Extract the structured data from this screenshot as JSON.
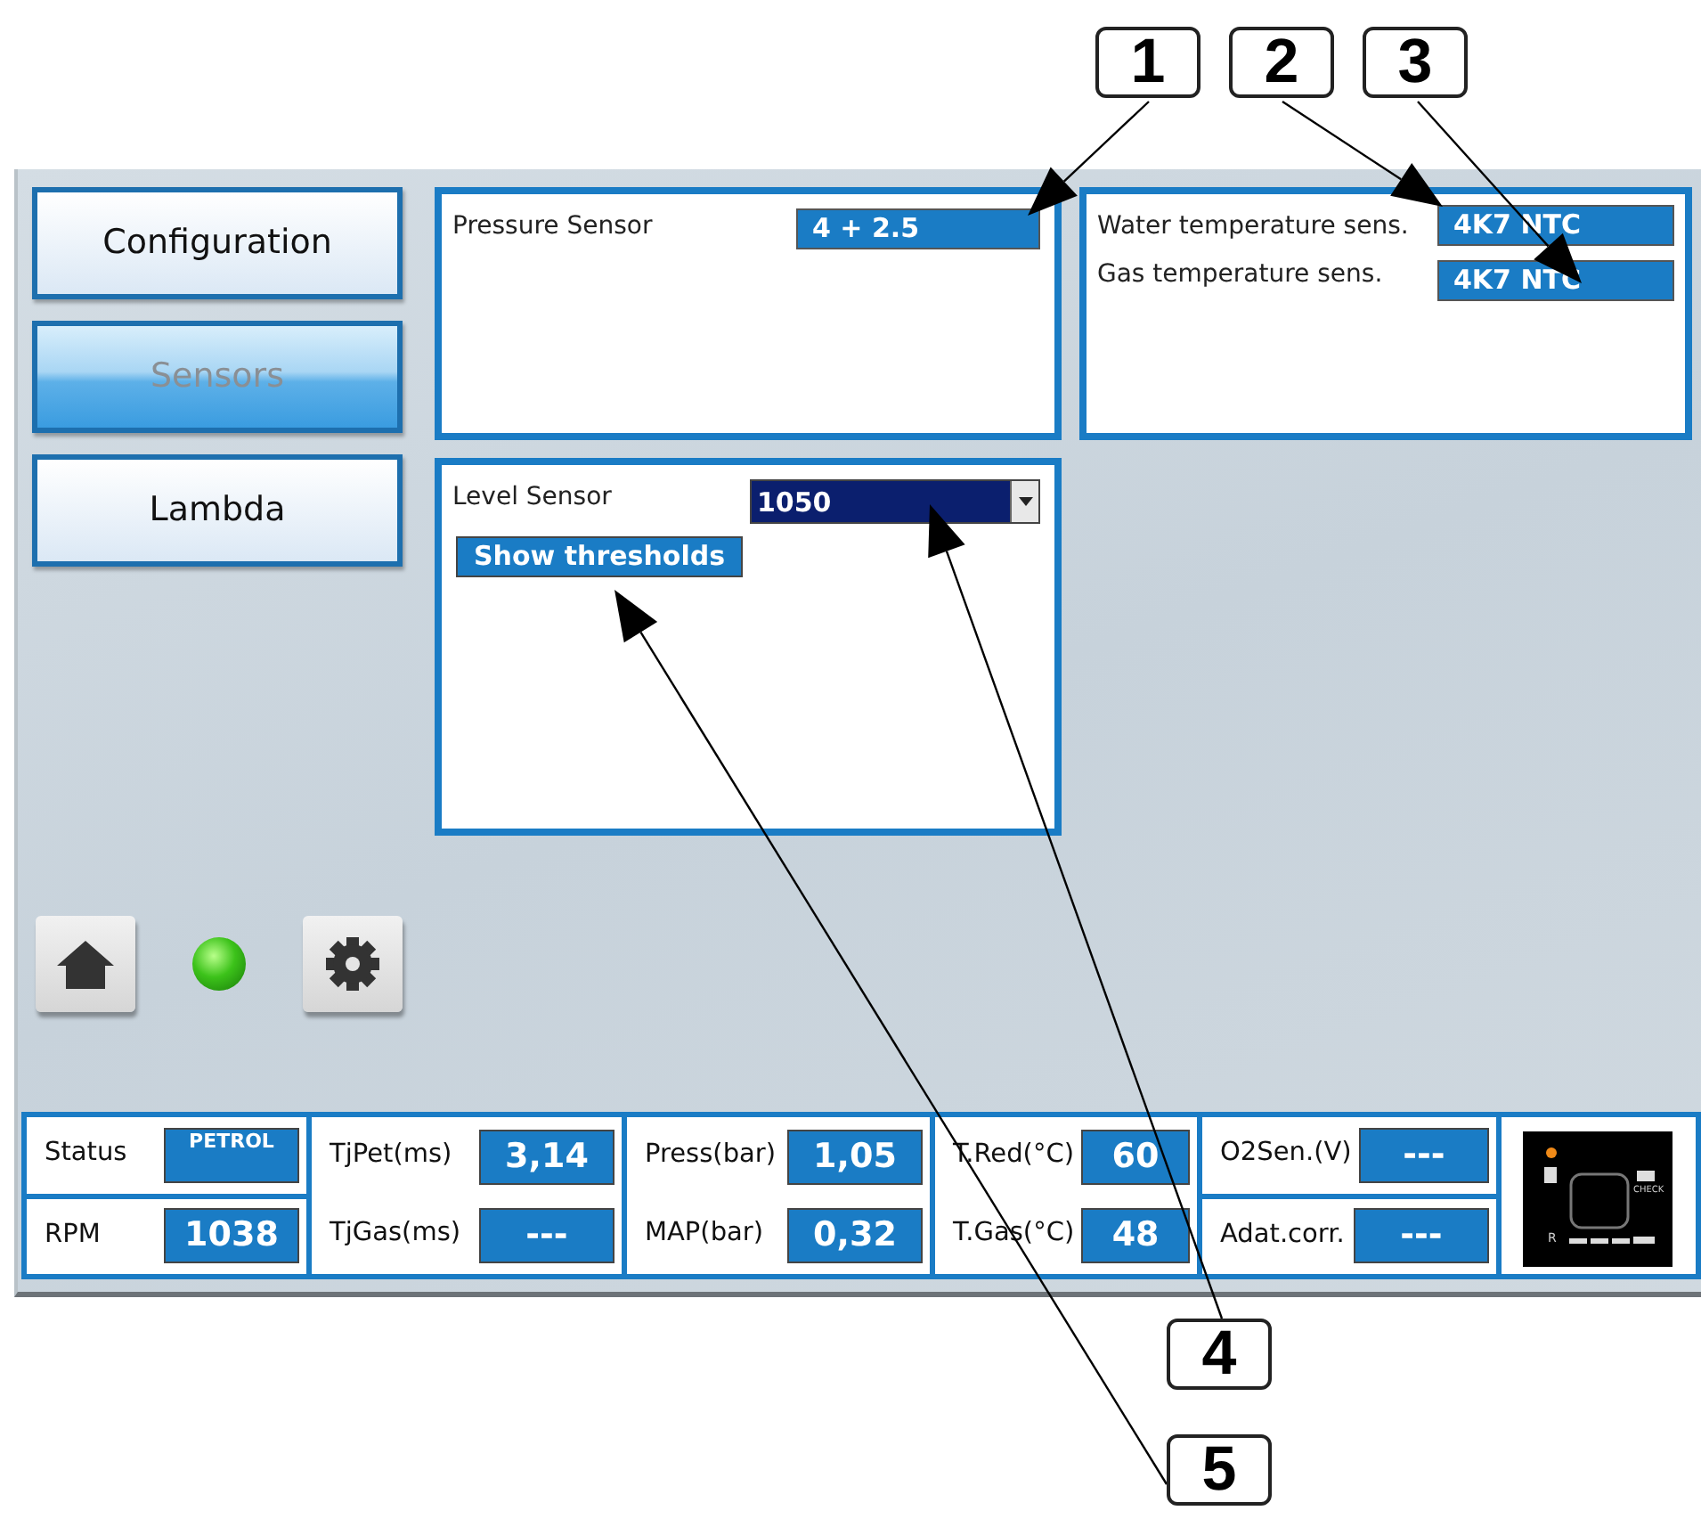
{
  "callouts": [
    {
      "label": "1"
    },
    {
      "label": "2"
    },
    {
      "label": "3"
    },
    {
      "label": "4"
    },
    {
      "label": "5"
    }
  ],
  "nav": [
    {
      "label": "Configuration",
      "selected": false
    },
    {
      "label": "Sensors",
      "selected": true
    },
    {
      "label": "Lambda",
      "selected": false
    }
  ],
  "pressure_panel": {
    "label": "Pressure Sensor",
    "value": "4 + 2.5"
  },
  "temperature_panel": {
    "rows": [
      {
        "label": "Water temperature sens.",
        "value": "4K7 NTC"
      },
      {
        "label": "Gas temperature sens.",
        "value": "4K7 NTC"
      }
    ]
  },
  "level_panel": {
    "label": "Level Sensor",
    "value": "1050",
    "button": "Show thresholds"
  },
  "status_led": {
    "on": true
  },
  "status_bar": {
    "groups": [
      {
        "cells": [
          {
            "label": "Status",
            "value": "PETROL",
            "kind": "mode"
          },
          {
            "label": "RPM",
            "value": "1038",
            "kind": "reading"
          }
        ]
      },
      {
        "cells": [
          {
            "label": "TjPet(ms)",
            "value": "3,14",
            "kind": "reading"
          },
          {
            "label": "TjGas(ms)",
            "value": "---",
            "kind": "reading"
          }
        ]
      },
      {
        "cells": [
          {
            "label": "Press(bar)",
            "value": "1,05",
            "kind": "reading"
          },
          {
            "label": "MAP(bar)",
            "value": "0,32",
            "kind": "reading"
          }
        ]
      },
      {
        "cells": [
          {
            "label": "T.Red(°C)",
            "value": "60",
            "kind": "reading"
          },
          {
            "label": "T.Gas(°C)",
            "value": "48",
            "kind": "reading"
          }
        ]
      },
      {
        "cells": [
          {
            "label": "O2Sen.(V)",
            "value": "---",
            "kind": "reading"
          },
          {
            "label": "Adat.corr.",
            "value": "---",
            "kind": "reading"
          }
        ]
      }
    ]
  },
  "indicator": {
    "check_label": "CHECK",
    "reserve_label": "R"
  }
}
